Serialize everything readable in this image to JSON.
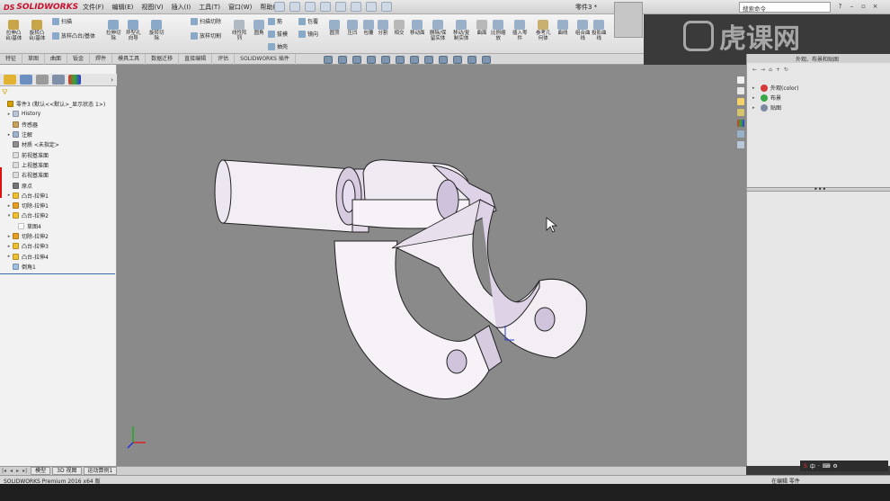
{
  "app": {
    "brand": "SOLIDWORKS",
    "menus": [
      "文件(F)",
      "编辑(E)",
      "视图(V)",
      "插入(I)",
      "工具(T)",
      "窗口(W)",
      "帮助(H)"
    ],
    "document_title": "零件3 *",
    "search_placeholder": "搜索命令"
  },
  "ribbon": {
    "buttons": [
      {
        "label": "拉伸凸\n台/基体",
        "icon": "extrude-boss-icon"
      },
      {
        "label": "旋转凸\n台/基体",
        "icon": "revolve-boss-icon"
      },
      {
        "label": "拉伸切\n除",
        "icon": "extrude-cut-icon"
      },
      {
        "label": "异型孔\n向导",
        "icon": "hole-wizard-icon"
      },
      {
        "label": "旋转切\n除",
        "icon": "revolve-cut-icon"
      },
      {
        "label": "线性阵\n列",
        "icon": "linear-pattern-icon"
      },
      {
        "label": "圆角",
        "icon": "fillet-icon"
      },
      {
        "label": "圆顶",
        "icon": "dome-icon"
      },
      {
        "label": "压凹",
        "icon": "indent-icon"
      },
      {
        "label": "包覆",
        "icon": "wrap-icon"
      },
      {
        "label": "分割",
        "icon": "split-icon"
      },
      {
        "label": "相交",
        "icon": "intersect-icon"
      },
      {
        "label": "移动面",
        "icon": "move-face-icon"
      },
      {
        "label": "删除/保\n留实体",
        "icon": "delete-body-icon"
      },
      {
        "label": "移动/复\n制实体",
        "icon": "move-copy-icon"
      },
      {
        "label": "曲面",
        "icon": "surface-icon"
      },
      {
        "label": "比例缩\n放",
        "icon": "scale-icon"
      },
      {
        "label": "插入零\n件",
        "icon": "insert-part-icon"
      },
      {
        "label": "参考几\n何体",
        "icon": "reference-geometry-icon"
      },
      {
        "label": "曲线",
        "icon": "curve-icon"
      },
      {
        "label": "组合曲\n线",
        "icon": "composite-curve-icon"
      },
      {
        "label": "投影曲\n线",
        "icon": "projected-curve-icon"
      },
      {
        "label": "Instant3D",
        "icon": "instant3d-icon"
      }
    ],
    "small": [
      {
        "label": "扫描",
        "icon": "sweep-icon"
      },
      {
        "label": "放样凸台/基体",
        "icon": "loft-icon"
      },
      {
        "label": "扫描切除",
        "icon": "sweep-cut-icon"
      },
      {
        "label": "放样切割",
        "icon": "loft-cut-icon"
      },
      {
        "label": "筋",
        "icon": "rib-icon"
      },
      {
        "label": "拔模",
        "icon": "draft-icon"
      },
      {
        "label": "抽壳",
        "icon": "shell-icon"
      },
      {
        "label": "包覆",
        "icon": "wrap-small-icon"
      },
      {
        "label": "镜向",
        "icon": "mirror-icon"
      }
    ]
  },
  "command_tabs": [
    "特征",
    "草图",
    "曲面",
    "钣金",
    "焊件",
    "模具工具",
    "数据迁移",
    "直接编辑",
    "评估",
    "SOLIDWORKS 插件"
  ],
  "feature_tree": [
    {
      "label": "零件3 (默认<<默认>_显示状态 1>)",
      "indent": 0,
      "expand": "",
      "color": "#d4a000"
    },
    {
      "label": "History",
      "indent": 1,
      "expand": "▸",
      "color": "#b9c7d8"
    },
    {
      "label": "传感器",
      "indent": 1,
      "expand": "",
      "color": "#c9a35a"
    },
    {
      "label": "注解",
      "indent": 1,
      "expand": "▸",
      "color": "#9fb4cc"
    },
    {
      "label": "材质 <未指定>",
      "indent": 1,
      "expand": "",
      "color": "#8f8f8f"
    },
    {
      "label": "前视基准面",
      "indent": 1,
      "expand": "",
      "color": "#dddddd"
    },
    {
      "label": "上视基准面",
      "indent": 1,
      "expand": "",
      "color": "#dddddd"
    },
    {
      "label": "右视基准面",
      "indent": 1,
      "expand": "",
      "color": "#dddddd"
    },
    {
      "label": "原点",
      "indent": 1,
      "expand": "",
      "color": "#777777"
    },
    {
      "label": "凸台-拉伸1",
      "indent": 1,
      "expand": "▸",
      "color": "#f0c030"
    },
    {
      "label": "切除-拉伸1",
      "indent": 1,
      "expand": "▸",
      "color": "#e8a020"
    },
    {
      "label": "凸台-拉伸2",
      "indent": 1,
      "expand": "▾",
      "color": "#f0c030"
    },
    {
      "label": "草图4",
      "indent": 2,
      "expand": "",
      "color": "#ffffff"
    },
    {
      "label": "切除-拉伸2",
      "indent": 1,
      "expand": "▸",
      "color": "#e8a020"
    },
    {
      "label": "凸台-拉伸3",
      "indent": 1,
      "expand": "▸",
      "color": "#f0c030"
    },
    {
      "label": "凸台-拉伸4",
      "indent": 1,
      "expand": "▸",
      "color": "#f0c030"
    },
    {
      "label": "倒角1",
      "indent": 1,
      "expand": "",
      "color": "#9fc0e0"
    }
  ],
  "task_pane": {
    "title": "外观、布景和贴图",
    "items": [
      {
        "label": "外观(color)",
        "color": "#d43a3a"
      },
      {
        "label": "布景",
        "color": "#3aa84a"
      },
      {
        "label": "贴图",
        "color": "#7a8aa0"
      }
    ]
  },
  "bottom_tabs": [
    "模型",
    "3D 视图",
    "运动算例1"
  ],
  "status": {
    "left": "SOLIDWORKS Premium 2016 x64 版",
    "right": "在编辑 零件"
  },
  "watermark": "虎课网",
  "colors": {
    "viewport_bg": "#8a8a8a",
    "part_face": "#f2eef4",
    "part_shade": "#d9cfe0",
    "accent": "#c8102e"
  }
}
